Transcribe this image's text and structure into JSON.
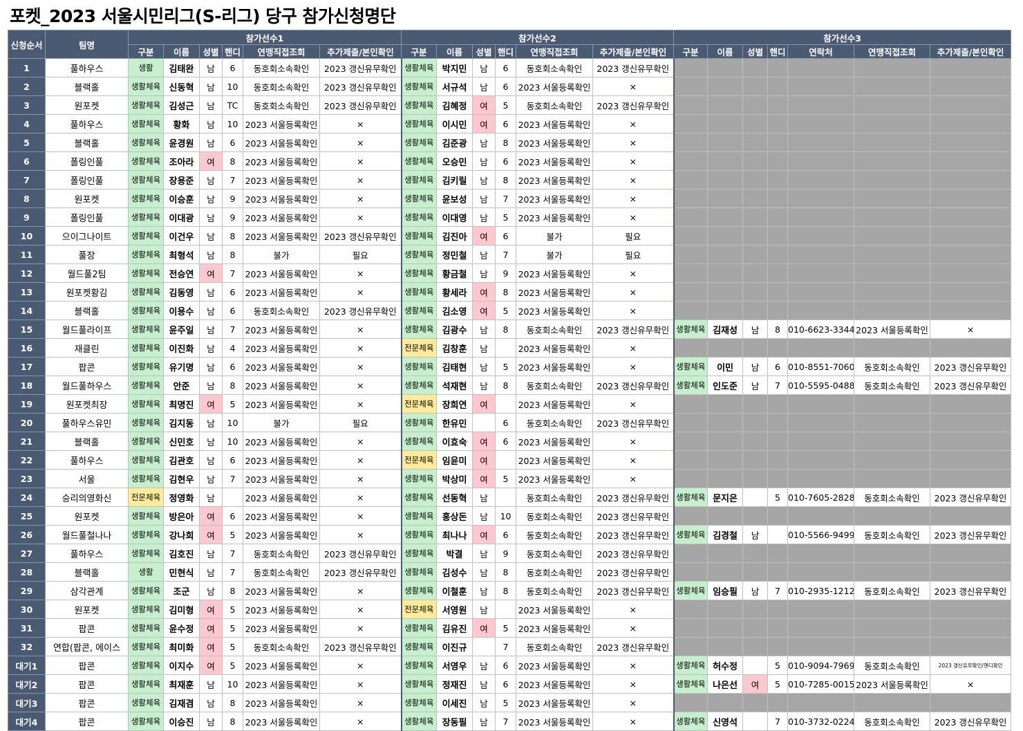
{
  "title": "포켓_2023 서울시민리그(S-리그) 당구 참가신청명단",
  "header": {
    "seq": "신청순서",
    "team": "팀명",
    "groups": [
      "참가선수1",
      "참가선수2",
      "참가선수3"
    ],
    "p_cols": [
      "구분",
      "이름",
      "성별",
      "핸디",
      "연맹직접조회",
      "추가제출/본인확인"
    ],
    "p3_cols": [
      "구분",
      "이름",
      "성별",
      "핸디",
      "연락처",
      "연맹직접조회",
      "추가제출/본인확인"
    ]
  },
  "rows": [
    {
      "seq": "1",
      "team": "풀하우스",
      "p1": [
        "생활",
        "김태완",
        "남",
        "6",
        "동호회소속확인",
        "2023 갱신유무확인"
      ],
      "p2": [
        "생활체육",
        "박지민",
        "남",
        "6",
        "동호회소속확인",
        "2023 갱신유무확인"
      ],
      "p3": null
    },
    {
      "seq": "2",
      "team": "블랙홀",
      "p1": [
        "생활체육",
        "신동혁",
        "남",
        "10",
        "동호회소속확인",
        "2023 갱신유무확인"
      ],
      "p2": [
        "생활체육",
        "서규석",
        "남",
        "6",
        "2023 서울등록확인",
        "×"
      ],
      "p3": null
    },
    {
      "seq": "3",
      "team": "원포켓",
      "p1": [
        "생활체육",
        "김성근",
        "남",
        "TC",
        "동호회소속확인",
        "2023 갱신유무확인"
      ],
      "p2": [
        "생활체육",
        "김혜정",
        "여",
        "5",
        "동호회소속확인",
        "2023 갱신유무확인"
      ],
      "p3": null
    },
    {
      "seq": "4",
      "team": "풀하우스",
      "p1": [
        "생활체육",
        "황화",
        "남",
        "10",
        "2023 서울등록확인",
        "×"
      ],
      "p2": [
        "생활체육",
        "이시민",
        "여",
        "6",
        "2023 서울등록확인",
        "×"
      ],
      "p3": null
    },
    {
      "seq": "5",
      "team": "블랙홀",
      "p1": [
        "생활체육",
        "윤경원",
        "남",
        "6",
        "2023 서울등록확인",
        "×"
      ],
      "p2": [
        "생활체육",
        "김준광",
        "남",
        "8",
        "2023 서울등록확인",
        "×"
      ],
      "p3": null
    },
    {
      "seq": "6",
      "team": "폴링인풀",
      "p1": [
        "생활체육",
        "조아라",
        "여",
        "8",
        "2023 서울등록확인",
        "×"
      ],
      "p2": [
        "생활체육",
        "오승민",
        "남",
        "6",
        "2023 서울등록확인",
        "×"
      ],
      "p3": null
    },
    {
      "seq": "7",
      "team": "폴링인풀",
      "p1": [
        "생활체육",
        "장용준",
        "남",
        "7",
        "2023 서울등록확인",
        "×"
      ],
      "p2": [
        "생활체육",
        "김키릴",
        "남",
        "8",
        "2023 서울등록확인",
        "×"
      ],
      "p3": null
    },
    {
      "seq": "8",
      "team": "원포켓",
      "p1": [
        "생활체육",
        "이승훈",
        "남",
        "9",
        "2023 서울등록확인",
        "×"
      ],
      "p2": [
        "생활체육",
        "윤보성",
        "남",
        "7",
        "2023 서울등록확인",
        "×"
      ],
      "p3": null
    },
    {
      "seq": "9",
      "team": "폴링인풀",
      "p1": [
        "생활체육",
        "이대광",
        "남",
        "9",
        "2023 서울등록확인",
        "×"
      ],
      "p2": [
        "생활체육",
        "이대영",
        "남",
        "5",
        "2023 서울등록확인",
        "×"
      ],
      "p3": null
    },
    {
      "seq": "10",
      "team": "으이그나이트",
      "p1": [
        "생활체육",
        "이건우",
        "남",
        "8",
        "2023 서울등록확인",
        "2023 갱신유무확인"
      ],
      "p2": [
        "생활체육",
        "김진아",
        "여",
        "6",
        "불가",
        "필요"
      ],
      "p3": null
    },
    {
      "seq": "11",
      "team": "풀장",
      "p1": [
        "생활체육",
        "최형석",
        "남",
        "8",
        "불가",
        "필요"
      ],
      "p2": [
        "생활체육",
        "정민철",
        "남",
        "7",
        "불가",
        "필요"
      ],
      "p3": null
    },
    {
      "seq": "12",
      "team": "월드풀2팀",
      "p1": [
        "생활체육",
        "전승연",
        "여",
        "7",
        "2023 서울등록확인",
        "×"
      ],
      "p2": [
        "생활체육",
        "황금철",
        "남",
        "9",
        "2023 서울등록확인",
        "×"
      ],
      "p3": null
    },
    {
      "seq": "13",
      "team": "원포켓황김",
      "p1": [
        "생활체육",
        "김동영",
        "남",
        "6",
        "2023 서울등록확인",
        "×"
      ],
      "p2": [
        "생활체육",
        "황세라",
        "여",
        "8",
        "2023 서울등록확인",
        "×"
      ],
      "p3": null
    },
    {
      "seq": "14",
      "team": "블랙홀",
      "p1": [
        "생활체육",
        "이용수",
        "남",
        "6",
        "동호회소속확인",
        "2023 갱신유무확인"
      ],
      "p2": [
        "생활체육",
        "김소영",
        "여",
        "5",
        "2023 서울등록확인",
        "×"
      ],
      "p3": null
    },
    {
      "seq": "15",
      "team": "월드풀라이프",
      "p1": [
        "생활체육",
        "윤주일",
        "남",
        "7",
        "2023 서울등록확인",
        "×"
      ],
      "p2": [
        "생활체육",
        "김광수",
        "남",
        "8",
        "동호회소속확인",
        "2023 갱신유무확인"
      ],
      "p3": [
        "생활체육",
        "김재성",
        "남",
        "8",
        "010-6623-3344",
        "2023 서울등록확인",
        "×"
      ]
    },
    {
      "seq": "16",
      "team": "재클린",
      "p1": [
        "생활체육",
        "이진화",
        "남",
        "4",
        "2023 서울등록확인",
        "×"
      ],
      "p2": [
        "전문체육",
        "김창훈",
        "남",
        "",
        "2023 서울등록확인",
        "×"
      ],
      "p3": null
    },
    {
      "seq": "17",
      "team": "팝콘",
      "p1": [
        "생활체육",
        "유기명",
        "남",
        "6",
        "2023 서울등록확인",
        "×"
      ],
      "p2": [
        "생활체육",
        "김태현",
        "남",
        "5",
        "2023 서울등록확인",
        "×"
      ],
      "p3": [
        "생활체육",
        "이민",
        "남",
        "6",
        "010-8551-7060",
        "동호회소속확인",
        "2023 갱신유무확인"
      ]
    },
    {
      "seq": "18",
      "team": "월드풀하우스",
      "p1": [
        "생활체육",
        "안준",
        "남",
        "8",
        "2023 서울등록확인",
        "×"
      ],
      "p2": [
        "생활체육",
        "석재현",
        "남",
        "8",
        "동호회소속확인",
        "2023 갱신유무확인"
      ],
      "p3": [
        "생활체육",
        "인도준",
        "남",
        "7",
        "010-5595-0488",
        "동호회소속확인",
        "2023 갱신유무확인"
      ]
    },
    {
      "seq": "19",
      "team": "원포켓최장",
      "p1": [
        "생활체육",
        "최명진",
        "여",
        "5",
        "2023 서울등록확인",
        "×"
      ],
      "p2": [
        "전문체육",
        "장희연",
        "여",
        "",
        "2023 서울등록확인",
        "×"
      ],
      "p3": null
    },
    {
      "seq": "20",
      "team": "풀하우스유민",
      "p1": [
        "생활체육",
        "김지동",
        "남",
        "10",
        "불가",
        "필요"
      ],
      "p2": [
        "생활체육",
        "한유민",
        "",
        "6",
        "동호회소속확인",
        "2023 갱신유무확인"
      ],
      "p3": null
    },
    {
      "seq": "21",
      "team": "블랙홀",
      "p1": [
        "생활체육",
        "신민호",
        "남",
        "10",
        "2023 서울등록확인",
        "×"
      ],
      "p2": [
        "생활체육",
        "이효숙",
        "여",
        "6",
        "2023 서울등록확인",
        "×"
      ],
      "p3": null
    },
    {
      "seq": "22",
      "team": "풀하우스",
      "p1": [
        "생활체육",
        "김관호",
        "남",
        "6",
        "2023 서울등록확인",
        "×"
      ],
      "p2": [
        "전문체육",
        "임윤미",
        "여",
        "",
        "2023 서울등록확인",
        "×"
      ],
      "p3": null
    },
    {
      "seq": "23",
      "team": "서울",
      "p1": [
        "생활체육",
        "김현우",
        "남",
        "7",
        "2023 서울등록확인",
        "×"
      ],
      "p2": [
        "생활체육",
        "박상미",
        "여",
        "5",
        "2023 서울등록확인",
        "×"
      ],
      "p3": null
    },
    {
      "seq": "24",
      "team": "승리의영화신",
      "p1": [
        "전문체육",
        "정영화",
        "남",
        "",
        "2023 서울등록확인",
        "×"
      ],
      "p2": [
        "생활체육",
        "선동혁",
        "남",
        "",
        "동호회소속확인",
        "2023 갱신유무확인"
      ],
      "p3": [
        "생활체육",
        "문지은",
        "",
        "5",
        "010-7605-2828",
        "동호회소속확인",
        "2023 갱신유무확인"
      ]
    },
    {
      "seq": "25",
      "team": "원포켓",
      "p1": [
        "생활체육",
        "방은아",
        "여",
        "6",
        "2023 서울등록확인",
        "×"
      ],
      "p2": [
        "생활체육",
        "홍상돈",
        "남",
        "10",
        "동호회소속확인",
        "2023 갱신유무확인"
      ],
      "p3": null
    },
    {
      "seq": "26",
      "team": "월드풀철나나",
      "p1": [
        "생활체육",
        "강나희",
        "여",
        "5",
        "2023 서울등록확인",
        "×"
      ],
      "p2": [
        "생활체육",
        "최나나",
        "여",
        "6",
        "동호회소속확인",
        "2023 갱신유무확인"
      ],
      "p3": [
        "생활체육",
        "김경철",
        "남",
        "",
        "010-5566-9499",
        "동호회소속확인",
        "2023 갱신유무확인"
      ]
    },
    {
      "seq": "27",
      "team": "풀하우스",
      "p1": [
        "생활체육",
        "김호진",
        "남",
        "7",
        "동호회소속확인",
        "2023 갱신유무확인"
      ],
      "p2": [
        "생활체육",
        "박결",
        "남",
        "9",
        "동호회소속확인",
        "2023 갱신유무확인"
      ],
      "p3": null
    },
    {
      "seq": "28",
      "team": "블랙홀",
      "p1": [
        "생활",
        "민현식",
        "남",
        "7",
        "동호회소속확인",
        "2023 갱신유무확인"
      ],
      "p2": [
        "생활체육",
        "김성수",
        "남",
        "8",
        "동호회소속확인",
        "2023 갱신유무확인"
      ],
      "p3": null
    },
    {
      "seq": "29",
      "team": "삼각관계",
      "p1": [
        "생활체육",
        "조군",
        "남",
        "8",
        "2023 서울등록확인",
        "×"
      ],
      "p2": [
        "생활체육",
        "이철훈",
        "남",
        "8",
        "동호회소속확인",
        "2023 갱신유무확인"
      ],
      "p3": [
        "생활체육",
        "임승필",
        "남",
        "7",
        "010-2935-1212",
        "동호회소속확인",
        "2023 갱신유무확인"
      ]
    },
    {
      "seq": "30",
      "team": "원포켓",
      "p1": [
        "생활체육",
        "김미형",
        "여",
        "5",
        "2023 서울등록확인",
        "×"
      ],
      "p2": [
        "전문체육",
        "서영원",
        "남",
        "",
        "2023 서울등록확인",
        "×"
      ],
      "p3": null
    },
    {
      "seq": "31",
      "team": "팝콘",
      "p1": [
        "생활체육",
        "윤수정",
        "여",
        "5",
        "2023 서울등록확인",
        "×"
      ],
      "p2": [
        "생활체육",
        "김유진",
        "여",
        "5",
        "2023 서울등록확인",
        "×"
      ],
      "p3": null
    },
    {
      "seq": "32",
      "team": "연합(팝콘, 에이스",
      "p1": [
        "생활체육",
        "최미화",
        "여",
        "5",
        "동호회소속확인",
        "2023 갱신유무확인"
      ],
      "p2": [
        "생활체육",
        "이진규",
        "",
        "7",
        "동호회소속확인",
        "2023 갱신유무확인"
      ],
      "p3": null
    },
    {
      "seq": "대기1",
      "team": "팝콘",
      "p1": [
        "생활체육",
        "이지수",
        "여",
        "5",
        "2023 서울등록확인",
        "×"
      ],
      "p2": [
        "생활체육",
        "서영우",
        "남",
        "6",
        "2023 서울등록확인",
        "×"
      ],
      "p3": [
        "생활체육",
        "허수정",
        "",
        "5",
        "010-9094-7969",
        "동호회소속확인",
        "2023 갱신유무확인/핸디확인"
      ]
    },
    {
      "seq": "대기2",
      "team": "팝콘",
      "p1": [
        "생활체육",
        "최재훈",
        "남",
        "10",
        "2023 서울등록확인",
        "×"
      ],
      "p2": [
        "생활체육",
        "정재진",
        "남",
        "6",
        "2023 서울등록확인",
        "×"
      ],
      "p3": [
        "생활체육",
        "나은선",
        "여",
        "5",
        "010-7285-0015",
        "2023 서울등록확인",
        "×"
      ]
    },
    {
      "seq": "대기3",
      "team": "팝콘",
      "p1": [
        "생활체육",
        "김재겸",
        "남",
        "8",
        "2023 서울등록확인",
        "×"
      ],
      "p2": [
        "생활체육",
        "이세진",
        "남",
        "5",
        "2023 서울등록확인",
        "×"
      ],
      "p3": null
    },
    {
      "seq": "대기4",
      "team": "팝콘",
      "p1": [
        "생활체육",
        "이승진",
        "남",
        "8",
        "2023 서울등록확인",
        "×"
      ],
      "p2": [
        "생활체육",
        "장동필",
        "남",
        "7",
        "2023 서울등록확인",
        "×"
      ],
      "p3": [
        "생활체육",
        "신영석",
        "",
        "7",
        "010-3732-0224",
        "동호회소속확인",
        "2023 갱신유무확인"
      ]
    }
  ],
  "colors": {
    "header": "#4a5a72",
    "green": "#c6efce",
    "yellow": "#ffeb9c",
    "pink": "#ffc7ce",
    "gray": "#a6a6a6"
  }
}
